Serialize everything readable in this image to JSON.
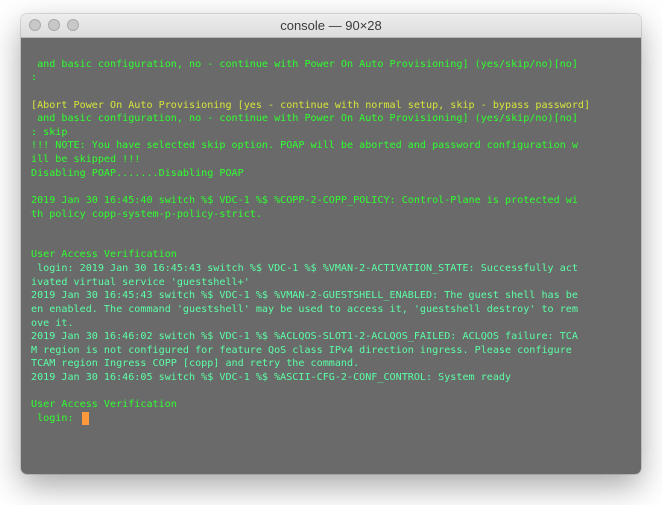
{
  "window": {
    "title": "console — 90×28"
  },
  "lines": {
    "l0": " and basic configuration, no - continue with Power On Auto Provisioning] (yes/skip/no)[no]",
    "l1": ":",
    "l2": "",
    "l3": "[Abort Power On Auto Provisioning [yes - continue with normal setup, skip - bypass password]",
    "l4": " and basic configuration, no - continue with Power On Auto Provisioning] (yes/skip/no)[no]",
    "l5": ": skip",
    "l6": "!!! NOTE: You have selected skip option. POAP will be aborted and password configuration w",
    "l7": "ill be skipped !!!",
    "l8": "Disabling POAP.......Disabling POAP",
    "l9": "",
    "l10": "2019 Jan 30 16:45:40 switch %$ VDC-1 %$ %COPP-2-COPP_POLICY: Control-Plane is protected wi",
    "l11": "th policy copp-system-p-policy-strict.",
    "l12": "",
    "l13": "",
    "l14": "User Access Verification",
    "l15": " login: 2019 Jan 30 16:45:43 switch %$ VDC-1 %$ %VMAN-2-ACTIVATION_STATE: Successfully act",
    "l16": "ivated virtual service 'guestshell+'",
    "l17": "2019 Jan 30 16:45:43 switch %$ VDC-1 %$ %VMAN-2-GUESTSHELL_ENABLED: The guest shell has be",
    "l18": "en enabled. The command 'guestshell' may be used to access it, 'guestshell destroy' to rem",
    "l19": "ove it.",
    "l20": "2019 Jan 30 16:46:02 switch %$ VDC-1 %$ %ACLQOS-SLOT1-2-ACLQOS_FAILED: ACLQOS failure: TCA",
    "l21": "M region is not configured for feature QoS class IPv4 direction ingress. Please configure",
    "l22": "TCAM region Ingress COPP [copp] and retry the command.",
    "l23": "2019 Jan 30 16:46:05 switch %$ VDC-1 %$ %ASCII-CFG-2-CONF_CONTROL: System ready",
    "l24": "",
    "l25": "User Access Verification",
    "l26": " login: "
  }
}
